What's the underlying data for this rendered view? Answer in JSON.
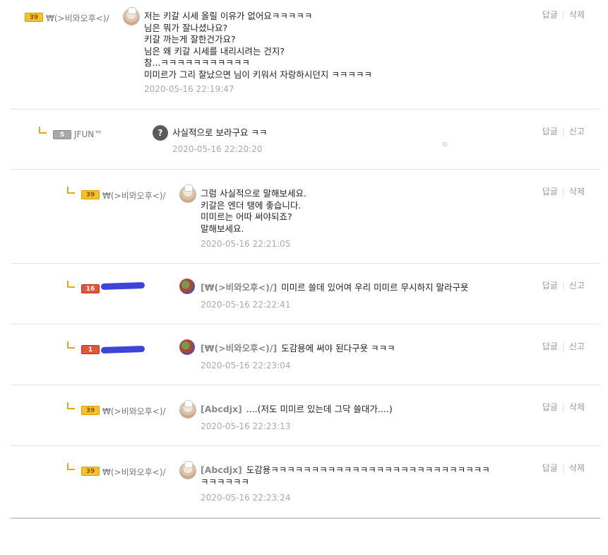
{
  "comments": [
    {
      "level": 0,
      "badge": "39",
      "nick": "₩(>비와오후<)/",
      "mention": "",
      "lines": "저는 키갈 시세 올릴 이유가 없어요ㅋㅋㅋㅋㅋ\n님은 뭐가 잘나셨나요?\n키갈 까는게 잘한건가요?\n님은 왜 키갈 시세를 내리시려는 건지?\n참...ㅋㅋㅋㅋㅋㅋㅋㅋㅋㅋㅋ\n미미르가 그리 잘났으면 님이 키워서 자랑하시던지 ㅋㅋㅋㅋㅋ",
      "date": "2020-05-16 22:19:47",
      "reply_label": "답글",
      "second_label": "삭제"
    },
    {
      "level": 1,
      "badge": "5",
      "nick": "JFUN™",
      "mention": "",
      "lines": "사실적으로 보라구요 ㅋㅋ",
      "date": "2020-05-16 22:20:20",
      "reply_label": "답글",
      "second_label": "신고"
    },
    {
      "level": 2,
      "badge": "39",
      "nick": "₩(>비와오후<)/",
      "mention": "",
      "lines": "그럼 사실적으로 말해보세요.\n키갈은 엔더 탱에 좋습니다.\n미미르는 어따 써야되죠?\n말해보세요.",
      "date": "2020-05-16 22:21:05",
      "reply_label": "답글",
      "second_label": "삭제"
    },
    {
      "level": 2,
      "badge": "16",
      "nick": "",
      "mention": "[₩(>비와오후<)/]",
      "lines": "미미르 쓸데 있어여 우리 미미르 무시하지 말라구욧",
      "date": "2020-05-16 22:22:41",
      "reply_label": "답글",
      "second_label": "신고"
    },
    {
      "level": 2,
      "badge": "1",
      "nick": "",
      "mention": "[₩(>비와오후<)/]",
      "lines": "도감용에 써야 된다구욧 ㅋㅋㅋ",
      "date": "2020-05-16 22:23:04",
      "reply_label": "답글",
      "second_label": "신고"
    },
    {
      "level": 2,
      "badge": "39",
      "nick": "₩(>비와오후<)/",
      "mention": "[Abcdjx]",
      "lines": "....(저도 미미르 있는데 그닥 쓸대가....)",
      "date": "2020-05-16 22:23:13",
      "reply_label": "답글",
      "second_label": "삭제"
    },
    {
      "level": 2,
      "badge": "39",
      "nick": "₩(>비와오후<)/",
      "mention": "[Abcdjx]",
      "lines": "도감용ㅋㅋㅋㅋㅋㅋㅋㅋㅋㅋㅋㅋㅋㅋㅋㅋㅋㅋㅋㅋㅋㅋㅋㅋㅋㅋㅋ\nㅋㅋㅋㅋㅋㅋ",
      "date": "2020-05-16 22:23:24",
      "reply_label": "답글",
      "second_label": "삭제"
    }
  ],
  "colors": {
    "reply_arrow": "#e6a817",
    "badge_gold": "#f5c12c",
    "badge_gray": "#a8a8a8",
    "badge_red": "#e1553c",
    "redaction": "#3d44d6"
  }
}
